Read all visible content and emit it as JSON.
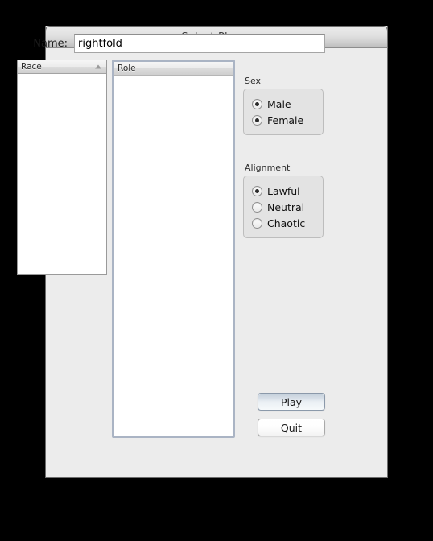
{
  "window": {
    "title": "Select Player"
  },
  "form": {
    "name_label": "Name:",
    "name_value": "rightfold",
    "name_placeholder": ""
  },
  "race_list": {
    "header": "Race",
    "sort_indicator": "sort-ascending-icon",
    "items": []
  },
  "role_list": {
    "header": "Role",
    "items": []
  },
  "sex_group": {
    "caption": "Sex",
    "options": [
      {
        "label": "Male",
        "selected": true
      },
      {
        "label": "Female",
        "selected": true
      }
    ]
  },
  "alignment_group": {
    "caption": "Alignment",
    "options": [
      {
        "label": "Lawful",
        "selected": true
      },
      {
        "label": "Neutral",
        "selected": false
      },
      {
        "label": "Chaotic",
        "selected": false
      }
    ]
  },
  "buttons": {
    "play_label": "Play",
    "quit_label": "Quit"
  },
  "colors": {
    "window_background": "#ececec",
    "titlebar_top": "#ebebeb",
    "titlebar_bottom": "#bdbdbd",
    "group_background": "#e3e3e3",
    "default_button_accent": "#c3ceda",
    "focus_ring": "#aab4c4",
    "canvas": "#000000"
  }
}
